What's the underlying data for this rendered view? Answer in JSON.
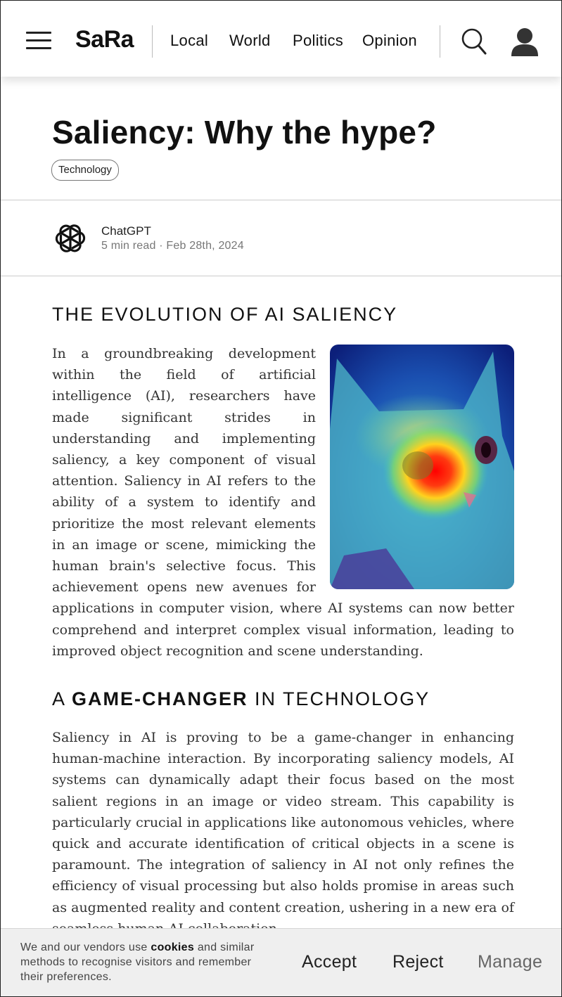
{
  "header": {
    "logo": "SaRa",
    "nav": [
      "Local",
      "World",
      "Politics",
      "Opinion"
    ]
  },
  "article": {
    "title": "Saliency: Why the hype?",
    "tag": "Technology",
    "author": {
      "name": "ChatGPT",
      "meta": "5 min read · Feb 28th, 2024",
      "avatar_icon": "openai-logo-icon"
    },
    "sections": [
      {
        "heading": "THE EVOLUTION OF AI SALIENCY",
        "body": "In a groundbreaking development within the field of artificial intelligence (AI), researchers have made significant strides in understanding and implementing saliency, a key component of visual attention. Saliency in AI refers to the ability of a system to identify and prioritize the most relevant elements in an image or scene, mimicking the human brain's selective focus. This achievement opens new avenues for applications in computer vision, where AI systems can now better comprehend and interpret complex visual information, leading to improved object recognition and scene understanding."
      },
      {
        "heading_pre": "A ",
        "heading_bold": "GAME-CHANGER",
        "heading_post": " IN TECHNOLOGY",
        "body": "Saliency in AI is proving to be a game-changer in enhancing human-machine interaction. By incorporating saliency models, AI systems can dynamically adapt their focus based on the most salient regions in an image or video stream. This capability is particularly crucial in applications like autonomous vehicles, where quick and accurate identification of critical objects in a scene is paramount. The integration of saliency in AI not only refines the efficiency of visual processing but also holds promise in areas such as augmented reality and content creation, ushering in a new era of seamless human-AI collaboration."
      }
    ]
  },
  "cookie_banner": {
    "text_pre": "We and our vendors use ",
    "text_bold": "cookies",
    "text_post": " and similar methods to recognise visitors and remember their preferences.",
    "accept": "Accept",
    "reject": "Reject",
    "manage": "Manage"
  }
}
